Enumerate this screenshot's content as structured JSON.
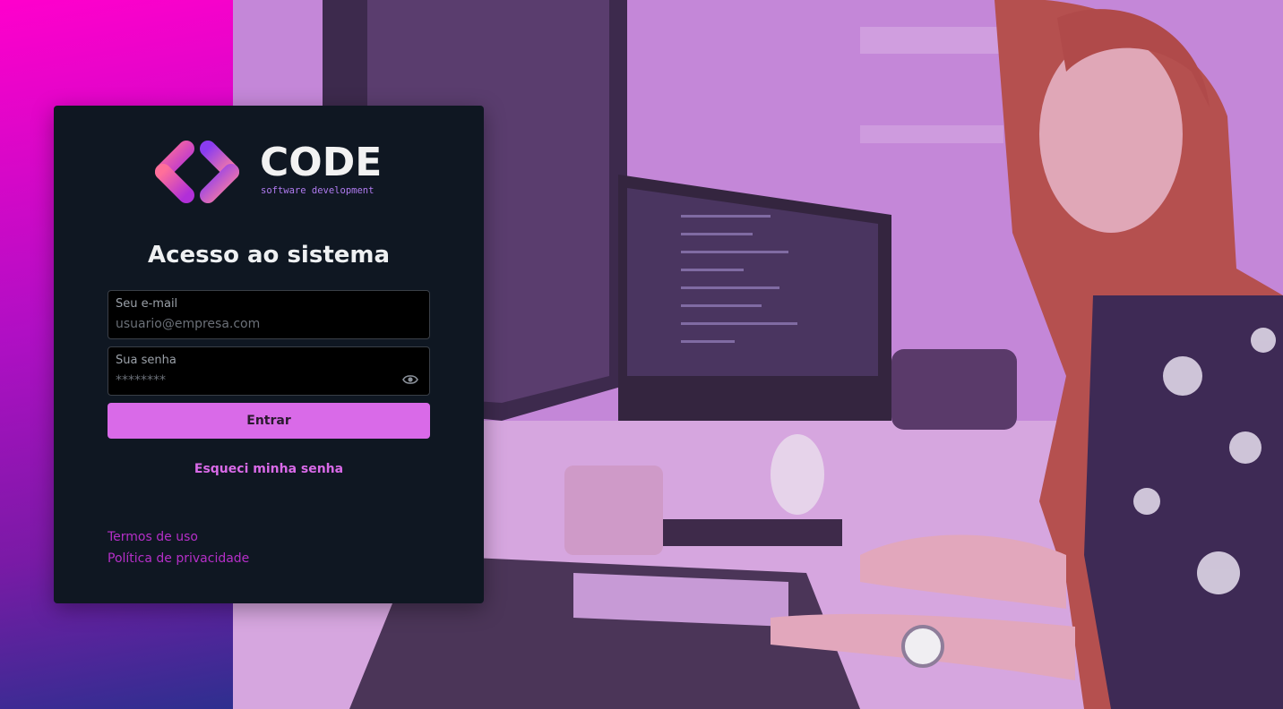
{
  "brand": {
    "name": "CODE",
    "tagline": "software development",
    "colors": {
      "accent": "#d96ae8",
      "link": "#b52fc8",
      "card_bg": "#0f1722",
      "gradient_top": "#ff00cc",
      "gradient_bottom": "#2e2f8f"
    }
  },
  "login": {
    "title": "Acesso ao sistema",
    "email": {
      "label": "Seu e-mail",
      "placeholder": "usuario@empresa.com",
      "value": ""
    },
    "password": {
      "label": "Sua senha",
      "placeholder": "********",
      "value": "",
      "toggle_icon": "eye-icon"
    },
    "submit_label": "Entrar",
    "forgot_label": "Esqueci minha senha"
  },
  "footer": {
    "terms_label": "Termos de uso",
    "privacy_label": "Política de privacidade"
  },
  "background": {
    "photo_description_icon": "office-photo"
  }
}
